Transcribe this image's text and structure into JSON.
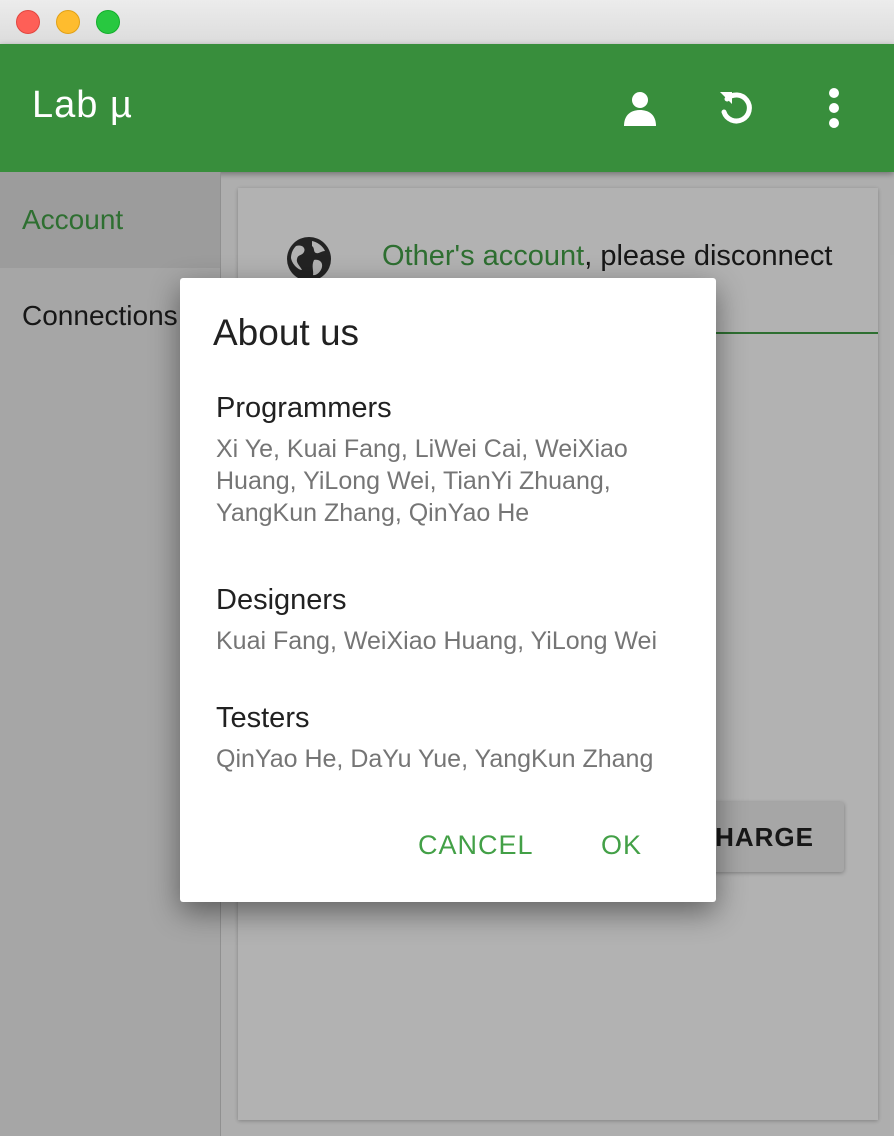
{
  "window": {
    "title": ""
  },
  "appbar": {
    "title": "Lab  µ",
    "icons": [
      "account-icon",
      "refresh-icon",
      "more-vert-icon"
    ]
  },
  "sidebar": {
    "items": [
      {
        "label": "Account",
        "active": true
      },
      {
        "label": "Connections",
        "active": false
      }
    ]
  },
  "content": {
    "account_link": "Other's account",
    "account_message": ", please disconnect",
    "charge_button": "CHARGE"
  },
  "dialog": {
    "title": "About us",
    "sections": [
      {
        "heading": "Programmers",
        "body": "Xi Ye, Kuai Fang, LiWei Cai, WeiXiao Huang, YiLong Wei, TianYi Zhuang, YangKun Zhang, QinYao He"
      },
      {
        "heading": "Designers",
        "body": "Kuai Fang, WeiXiao Huang, YiLong Wei"
      },
      {
        "heading": "Testers",
        "body": "QinYao He, DaYu Yue, YangKun Zhang"
      }
    ],
    "cancel_label": "CANCEL",
    "ok_label": "OK"
  },
  "colors": {
    "primary": "#388e3c",
    "accent": "#43a047"
  }
}
